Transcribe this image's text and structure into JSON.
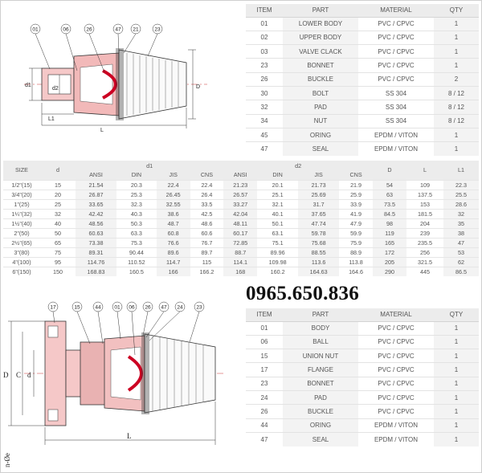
{
  "parts_top": {
    "headers": [
      "ITEM",
      "PART",
      "MATERIAL",
      "QTY"
    ],
    "rows": [
      [
        "01",
        "LOWER BODY",
        "PVC / CPVC",
        "1"
      ],
      [
        "02",
        "UPPER BODY",
        "PVC / CPVC",
        "1"
      ],
      [
        "03",
        "VALVE CLACK",
        "PVC / CPVC",
        "1"
      ],
      [
        "23",
        "BONNET",
        "PVC / CPVC",
        "1"
      ],
      [
        "26",
        "BUCKLE",
        "PVC / CPVC",
        "2"
      ],
      [
        "30",
        "BOLT",
        "SS 304",
        "8 / 12"
      ],
      [
        "32",
        "PAD",
        "SS 304",
        "8 / 12"
      ],
      [
        "34",
        "NUT",
        "SS 304",
        "8 / 12"
      ],
      [
        "45",
        "ORING",
        "EPDM / VITON",
        "1"
      ],
      [
        "47",
        "SEAL",
        "EPDM / VITON",
        "1"
      ]
    ]
  },
  "parts_bottom": {
    "headers": [
      "ITEM",
      "PART",
      "MATERIAL",
      "QTY"
    ],
    "rows": [
      [
        "01",
        "BODY",
        "PVC / CPVC",
        "1"
      ],
      [
        "06",
        "BALL",
        "PVC / CPVC",
        "1"
      ],
      [
        "15",
        "UNION NUT",
        "PVC / CPVC",
        "1"
      ],
      [
        "17",
        "FLANGE",
        "PVC / CPVC",
        "1"
      ],
      [
        "23",
        "BONNET",
        "PVC / CPVC",
        "1"
      ],
      [
        "24",
        "PAD",
        "PVC / CPVC",
        "1"
      ],
      [
        "26",
        "BUCKLE",
        "PVC / CPVC",
        "1"
      ],
      [
        "44",
        "ORING",
        "EPDM / VITON",
        "1"
      ],
      [
        "47",
        "SEAL",
        "EPDM / VITON",
        "1"
      ]
    ]
  },
  "dimensions": {
    "group_headers": {
      "size": "SIZE",
      "d": "d",
      "d1": "d1",
      "d2": "d2",
      "D": "D",
      "L": "L",
      "L1": "L1"
    },
    "sub_headers": [
      "ANSI",
      "DIN",
      "JIS",
      "CNS",
      "ANSI",
      "DIN",
      "JIS",
      "CNS"
    ],
    "rows": [
      [
        "1/2\"(15)",
        "15",
        "21.54",
        "20.3",
        "22.4",
        "22.4",
        "21.23",
        "20.1",
        "21.73",
        "21.9",
        "54",
        "109",
        "22.3"
      ],
      [
        "3/4\"(20)",
        "20",
        "26.87",
        "25.3",
        "26.45",
        "26.4",
        "26.57",
        "25.1",
        "25.69",
        "25.9",
        "63",
        "137.5",
        "25.5"
      ],
      [
        "1\"(25)",
        "25",
        "33.65",
        "32.3",
        "32.55",
        "33.5",
        "33.27",
        "32.1",
        "31.7",
        "33.9",
        "73.5",
        "153",
        "28.6"
      ],
      [
        "1¼\"(32)",
        "32",
        "42.42",
        "40.3",
        "38.6",
        "42.5",
        "42.04",
        "40.1",
        "37.65",
        "41.9",
        "84.5",
        "181.5",
        "32"
      ],
      [
        "1½\"(40)",
        "40",
        "48.56",
        "50.3",
        "48.7",
        "48.6",
        "48.11",
        "50.1",
        "47.74",
        "47.9",
        "98",
        "204",
        "35"
      ],
      [
        "2\"(50)",
        "50",
        "60.63",
        "63.3",
        "60.8",
        "60.6",
        "60.17",
        "63.1",
        "59.78",
        "59.9",
        "119",
        "239",
        "38"
      ],
      [
        "2½\"(65)",
        "65",
        "73.38",
        "75.3",
        "76.6",
        "76.7",
        "72.85",
        "75.1",
        "75.68",
        "75.9",
        "165",
        "235.5",
        "47"
      ],
      [
        "3\"(80)",
        "75",
        "89.31",
        "90.44",
        "89.6",
        "89.7",
        "88.7",
        "89.96",
        "88.55",
        "88.9",
        "172",
        "256",
        "53"
      ],
      [
        "4\"(100)",
        "95",
        "114.76",
        "110.52",
        "114.7",
        "115",
        "114.1",
        "109.98",
        "113.6",
        "113.8",
        "205",
        "321.5",
        "62"
      ],
      [
        "6\"(150)",
        "150",
        "168.83",
        "160.5",
        "166",
        "166.2",
        "168",
        "160.2",
        "164.63",
        "164.6",
        "290",
        "445",
        "86.5"
      ]
    ]
  },
  "phone": "0965.650.836",
  "top_drawing": {
    "callouts": [
      "01",
      "06",
      "26",
      "47",
      "21",
      "23"
    ],
    "dim_labels": {
      "d1": "d1",
      "d2": "d2",
      "D": "D",
      "L1": "L1",
      "L": "L"
    }
  },
  "bottom_drawing": {
    "callouts": [
      "17",
      "15",
      "44",
      "01",
      "06",
      "26",
      "47",
      "24",
      "23"
    ],
    "dim_labels": {
      "D": "D",
      "C": "C",
      "d": "d",
      "L": "L",
      "hole": "n-Øe"
    }
  }
}
